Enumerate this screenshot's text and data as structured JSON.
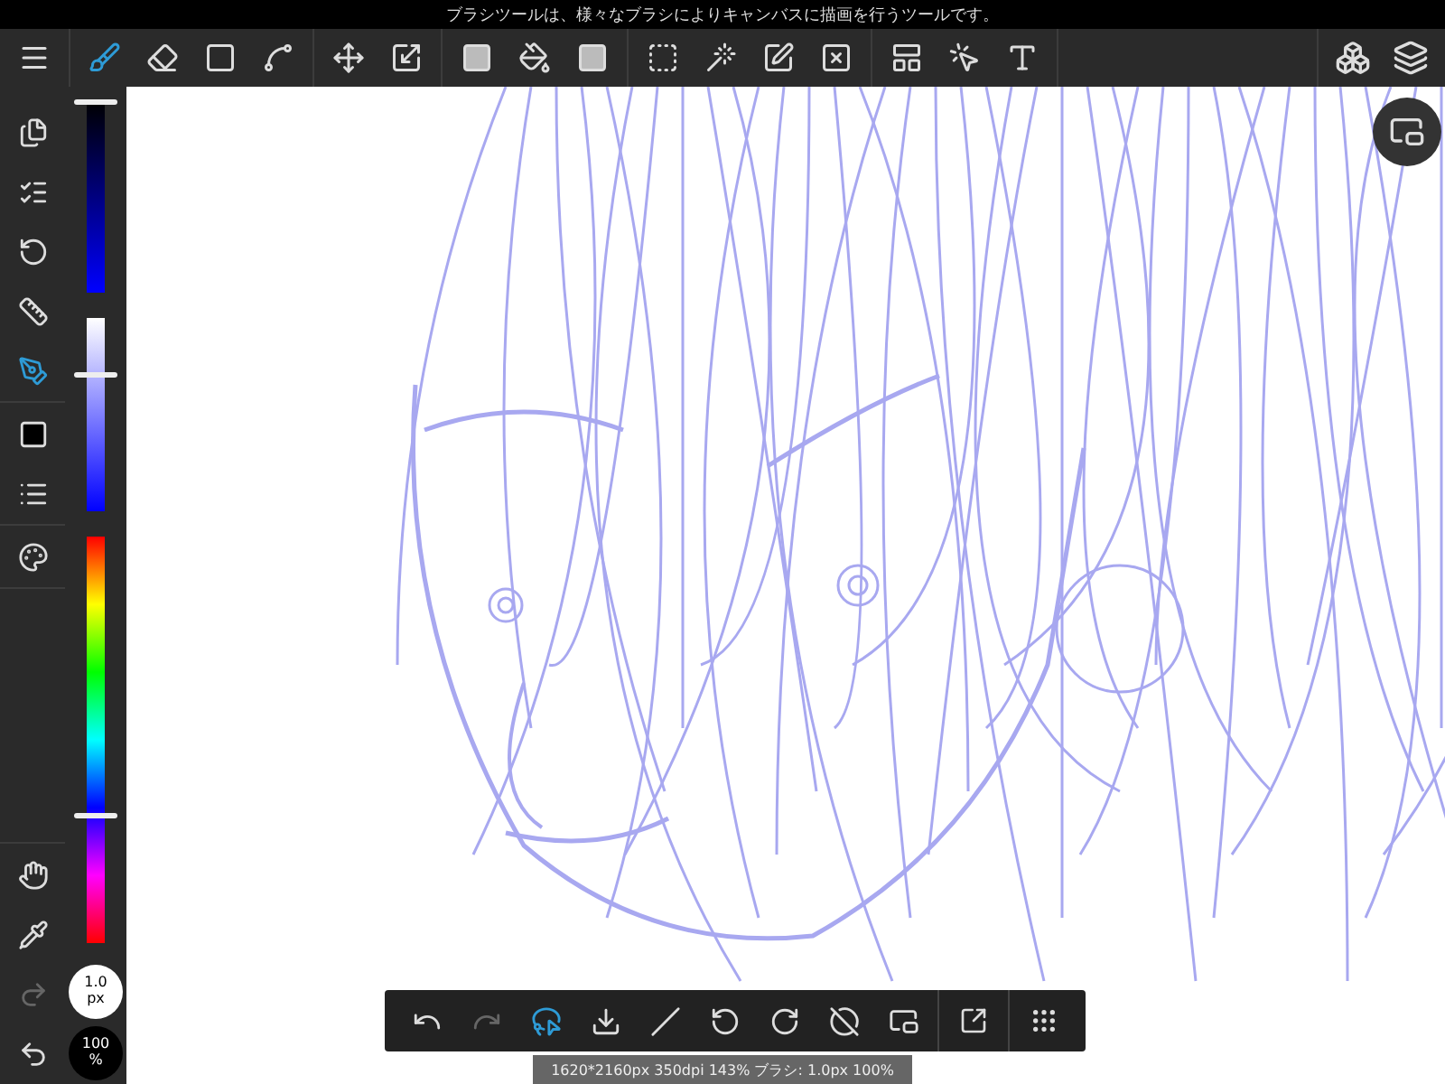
{
  "hint_bar": {
    "text": "ブラシツールは、様々なブラシによりキャンバスに描画を行うツールです。"
  },
  "top_toolbar": {
    "groups": [
      [
        {
          "selected": false
        }
      ],
      [
        {
          "selected": true
        },
        {
          "selected": false
        },
        {
          "selected": false
        },
        {
          "selected": false
        }
      ],
      [
        {
          "selected": false
        },
        {
          "selected": false
        }
      ],
      [
        {
          "selected": false
        },
        {
          "selected": false
        },
        {
          "selected": false
        }
      ],
      [
        {
          "selected": false
        },
        {
          "selected": false
        },
        {
          "selected": false
        },
        {
          "selected": false
        }
      ],
      [
        {
          "selected": false
        },
        {
          "selected": false
        },
        {
          "selected": false
        }
      ]
    ],
    "right": [
      {
        "selected": false
      },
      {
        "selected": false
      }
    ]
  },
  "left_toolbar": {
    "groups": [
      [
        {
          "selected": false
        },
        {
          "selected": false
        },
        {
          "selected": false
        },
        {
          "selected": false
        },
        {
          "selected": true
        }
      ],
      [
        {
          "selected": false
        },
        {
          "selected": false
        }
      ],
      [
        {
          "selected": false
        }
      ],
      [
        {
          "selected": false
        },
        {
          "selected": false
        },
        {
          "disabled": true
        },
        {
          "disabled": false
        }
      ]
    ]
  },
  "color_sliders": [
    {
      "kind": "brightness",
      "level": 1
    },
    {
      "kind": "saturation",
      "level": 0.71
    },
    {
      "kind": "hue",
      "level": 0.33
    }
  ],
  "brush_size": {
    "value": "1.0",
    "unit": "px"
  },
  "brush_opacity": {
    "value": "100",
    "unit": "%"
  },
  "bottom_toolbar": {
    "buttons": [
      {
        "disabled": false,
        "selected": false
      },
      {
        "disabled": true,
        "selected": false
      },
      {
        "disabled": false,
        "selected": true
      },
      {
        "disabled": false,
        "selected": false
      },
      {
        "disabled": false,
        "selected": false
      },
      {
        "disabled": false,
        "selected": false
      },
      {
        "disabled": false,
        "selected": false
      },
      {
        "disabled": false,
        "selected": false
      },
      {
        "disabled": false,
        "selected": false
      }
    ],
    "extra": [
      {
        "disabled": false
      },
      {
        "disabled": false
      }
    ]
  },
  "status_bar": {
    "text": "1620*2160px 350dpi 143% ブラシ: 1.0px 100%"
  }
}
